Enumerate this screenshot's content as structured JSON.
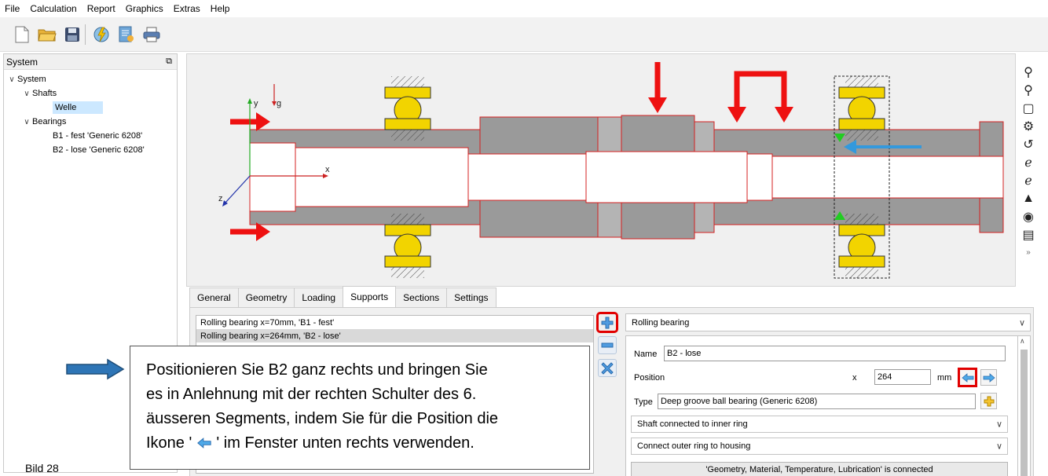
{
  "menu": [
    "File",
    "Calculation",
    "Report",
    "Graphics",
    "Extras",
    "Help"
  ],
  "toolbar": {
    "icons": [
      "new-file-icon",
      "open-folder-icon",
      "save-icon",
      "calculate-icon",
      "report-icon",
      "print-icon"
    ]
  },
  "system_panel": {
    "title": "System",
    "tree": {
      "root": "System",
      "shafts_label": "Shafts",
      "shaft": "Welle",
      "bearings_label": "Bearings",
      "bearings": [
        "B1 - fest 'Generic 6208'",
        "B2 - lose 'Generic 6208'"
      ]
    }
  },
  "graphic": {
    "axis_y": "y",
    "axis_x": "x",
    "axis_z": "z",
    "gravity": "g"
  },
  "tabs": [
    "General",
    "Geometry",
    "Loading",
    "Supports",
    "Sections",
    "Settings"
  ],
  "active_tab": "Supports",
  "supports_list": [
    "Rolling bearing  x=70mm, 'B1 - fest'",
    "Rolling bearing  x=264mm, 'B2 - lose'"
  ],
  "support_type": "Rolling bearing",
  "props": {
    "name_label": "Name",
    "name_value": "B2 - lose",
    "position_label": "Position",
    "x_label": "x",
    "position_value": "264",
    "unit": "mm",
    "type_label": "Type",
    "type_value": "Deep groove ball bearing (Generic 6208)",
    "inner_ring": "Shaft connected to inner ring",
    "outer_ring": "Connect outer ring to housing",
    "connected": "'Geometry, Material, Temperature, Lubrication' is connected"
  },
  "callout": {
    "lines": [
      "Positionieren Sie B2 ganz rechts und bringen Sie",
      "es in Anlehnung mit der rechten Schulter des 6.",
      "äusseren Segments, indem Sie für die Position die"
    ],
    "line4_before": "Ikone ' ",
    "line4_after": " ' im Fenster unten rechts verwenden."
  },
  "caption": "Bild 28",
  "colors": {
    "highlight": "#e10000",
    "load": "#ee1111",
    "axial": "#3399dd",
    "bearing": "#f2d400",
    "shaft": "#9a9a9a",
    "arrow_blue": "#1a6fc4"
  }
}
